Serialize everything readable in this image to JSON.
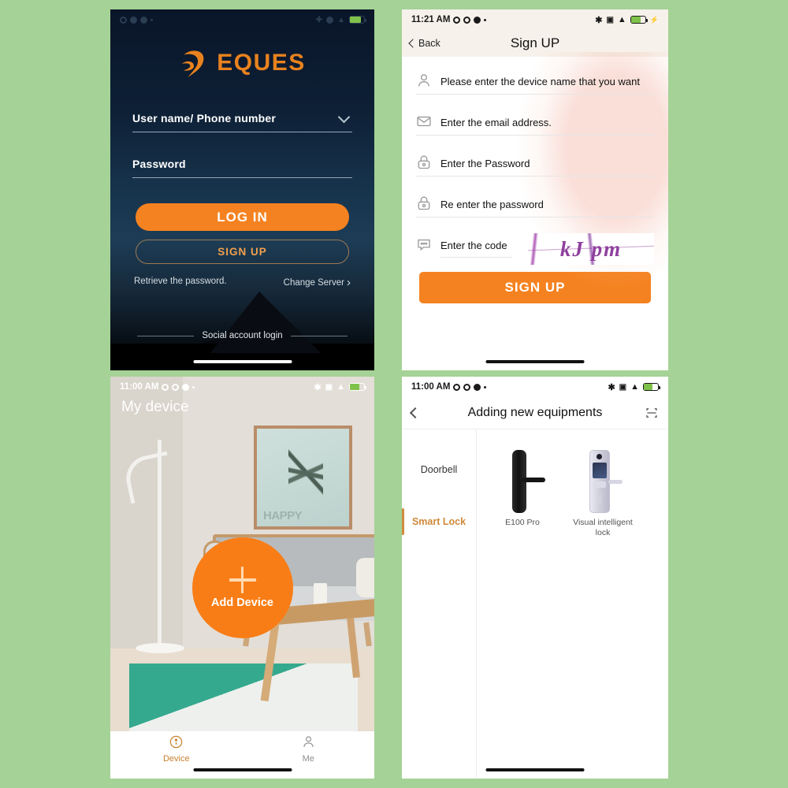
{
  "background_color": "#a5d296",
  "accent_color": "#f58220",
  "login": {
    "statusbar": {
      "time": "",
      "icons": [
        "bluetooth-icon",
        "alarm-icon",
        "wifi-icon",
        "battery-icon"
      ]
    },
    "brand": "EQUES",
    "username_field": {
      "label": "User name/ Phone number",
      "placeholder": "User name/ Phone number",
      "value": ""
    },
    "password_field": {
      "label": "Password",
      "placeholder": "Password",
      "value": ""
    },
    "login_button": "LOG IN",
    "signup_button": "SIGN UP",
    "retrieve_link": "Retrieve the password.",
    "change_server_link": "Change Server",
    "social_divider": "Social account login"
  },
  "signup": {
    "statusbar": {
      "time": "11:21 AM"
    },
    "back_label": "Back",
    "title": "Sign UP",
    "rows": [
      {
        "icon": "person-icon",
        "text": "Please enter the device name that you want",
        "value": ""
      },
      {
        "icon": "envelope-icon",
        "text": "Enter the email address.",
        "value": ""
      },
      {
        "icon": "lock-icon",
        "text": "Enter the Password",
        "value": ""
      },
      {
        "icon": "lock-icon",
        "text": "Re enter the password",
        "value": ""
      },
      {
        "icon": "chat-icon",
        "text": "Enter the code",
        "value": ""
      }
    ],
    "captcha_text": "kJ pm",
    "captcha_color": "#8f3f9e",
    "signup_button": "SIGN UP"
  },
  "my_device": {
    "statusbar": {
      "time": "11:00 AM"
    },
    "title": "My device",
    "add_button_label": "Add Device",
    "add_button_color": "#f97d16",
    "poster_text": "HAPPY",
    "tabs": [
      {
        "label": "Device",
        "icon": "device-icon",
        "active": true
      },
      {
        "label": "Me",
        "icon": "person-icon",
        "active": false
      }
    ]
  },
  "add_equipment": {
    "statusbar": {
      "time": "11:00 AM"
    },
    "title": "Adding new equipments",
    "scan_icon": "scan-icon",
    "categories": [
      {
        "label": "Doorbell",
        "active": false
      },
      {
        "label": "Smart Lock",
        "active": true
      }
    ],
    "devices": [
      {
        "name": "E100 Pro",
        "icon": "black-smart-lock-icon"
      },
      {
        "name": "Visual intelligent lock",
        "icon": "silver-visual-lock-icon"
      }
    ]
  }
}
